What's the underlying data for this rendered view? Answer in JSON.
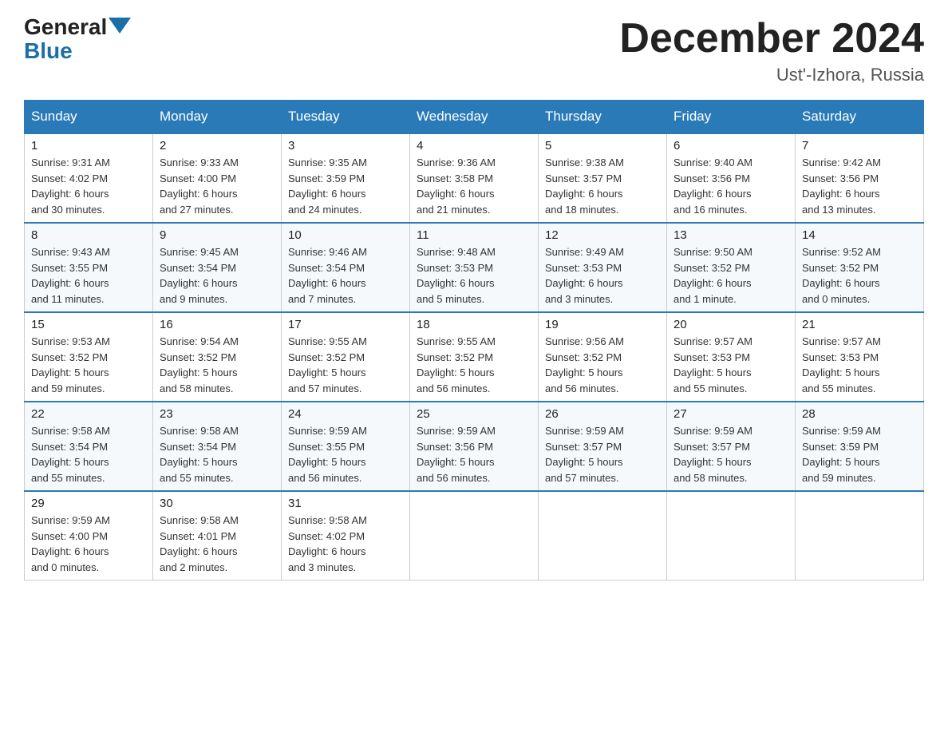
{
  "header": {
    "logo_general": "General",
    "logo_blue": "Blue",
    "month_title": "December 2024",
    "location": "Ust'-Izhora, Russia"
  },
  "weekdays": [
    "Sunday",
    "Monday",
    "Tuesday",
    "Wednesday",
    "Thursday",
    "Friday",
    "Saturday"
  ],
  "weeks": [
    [
      {
        "day": "1",
        "sunrise": "Sunrise: 9:31 AM",
        "sunset": "Sunset: 4:02 PM",
        "daylight": "Daylight: 6 hours",
        "daylight2": "and 30 minutes."
      },
      {
        "day": "2",
        "sunrise": "Sunrise: 9:33 AM",
        "sunset": "Sunset: 4:00 PM",
        "daylight": "Daylight: 6 hours",
        "daylight2": "and 27 minutes."
      },
      {
        "day": "3",
        "sunrise": "Sunrise: 9:35 AM",
        "sunset": "Sunset: 3:59 PM",
        "daylight": "Daylight: 6 hours",
        "daylight2": "and 24 minutes."
      },
      {
        "day": "4",
        "sunrise": "Sunrise: 9:36 AM",
        "sunset": "Sunset: 3:58 PM",
        "daylight": "Daylight: 6 hours",
        "daylight2": "and 21 minutes."
      },
      {
        "day": "5",
        "sunrise": "Sunrise: 9:38 AM",
        "sunset": "Sunset: 3:57 PM",
        "daylight": "Daylight: 6 hours",
        "daylight2": "and 18 minutes."
      },
      {
        "day": "6",
        "sunrise": "Sunrise: 9:40 AM",
        "sunset": "Sunset: 3:56 PM",
        "daylight": "Daylight: 6 hours",
        "daylight2": "and 16 minutes."
      },
      {
        "day": "7",
        "sunrise": "Sunrise: 9:42 AM",
        "sunset": "Sunset: 3:56 PM",
        "daylight": "Daylight: 6 hours",
        "daylight2": "and 13 minutes."
      }
    ],
    [
      {
        "day": "8",
        "sunrise": "Sunrise: 9:43 AM",
        "sunset": "Sunset: 3:55 PM",
        "daylight": "Daylight: 6 hours",
        "daylight2": "and 11 minutes."
      },
      {
        "day": "9",
        "sunrise": "Sunrise: 9:45 AM",
        "sunset": "Sunset: 3:54 PM",
        "daylight": "Daylight: 6 hours",
        "daylight2": "and 9 minutes."
      },
      {
        "day": "10",
        "sunrise": "Sunrise: 9:46 AM",
        "sunset": "Sunset: 3:54 PM",
        "daylight": "Daylight: 6 hours",
        "daylight2": "and 7 minutes."
      },
      {
        "day": "11",
        "sunrise": "Sunrise: 9:48 AM",
        "sunset": "Sunset: 3:53 PM",
        "daylight": "Daylight: 6 hours",
        "daylight2": "and 5 minutes."
      },
      {
        "day": "12",
        "sunrise": "Sunrise: 9:49 AM",
        "sunset": "Sunset: 3:53 PM",
        "daylight": "Daylight: 6 hours",
        "daylight2": "and 3 minutes."
      },
      {
        "day": "13",
        "sunrise": "Sunrise: 9:50 AM",
        "sunset": "Sunset: 3:52 PM",
        "daylight": "Daylight: 6 hours",
        "daylight2": "and 1 minute."
      },
      {
        "day": "14",
        "sunrise": "Sunrise: 9:52 AM",
        "sunset": "Sunset: 3:52 PM",
        "daylight": "Daylight: 6 hours",
        "daylight2": "and 0 minutes."
      }
    ],
    [
      {
        "day": "15",
        "sunrise": "Sunrise: 9:53 AM",
        "sunset": "Sunset: 3:52 PM",
        "daylight": "Daylight: 5 hours",
        "daylight2": "and 59 minutes."
      },
      {
        "day": "16",
        "sunrise": "Sunrise: 9:54 AM",
        "sunset": "Sunset: 3:52 PM",
        "daylight": "Daylight: 5 hours",
        "daylight2": "and 58 minutes."
      },
      {
        "day": "17",
        "sunrise": "Sunrise: 9:55 AM",
        "sunset": "Sunset: 3:52 PM",
        "daylight": "Daylight: 5 hours",
        "daylight2": "and 57 minutes."
      },
      {
        "day": "18",
        "sunrise": "Sunrise: 9:55 AM",
        "sunset": "Sunset: 3:52 PM",
        "daylight": "Daylight: 5 hours",
        "daylight2": "and 56 minutes."
      },
      {
        "day": "19",
        "sunrise": "Sunrise: 9:56 AM",
        "sunset": "Sunset: 3:52 PM",
        "daylight": "Daylight: 5 hours",
        "daylight2": "and 56 minutes."
      },
      {
        "day": "20",
        "sunrise": "Sunrise: 9:57 AM",
        "sunset": "Sunset: 3:53 PM",
        "daylight": "Daylight: 5 hours",
        "daylight2": "and 55 minutes."
      },
      {
        "day": "21",
        "sunrise": "Sunrise: 9:57 AM",
        "sunset": "Sunset: 3:53 PM",
        "daylight": "Daylight: 5 hours",
        "daylight2": "and 55 minutes."
      }
    ],
    [
      {
        "day": "22",
        "sunrise": "Sunrise: 9:58 AM",
        "sunset": "Sunset: 3:54 PM",
        "daylight": "Daylight: 5 hours",
        "daylight2": "and 55 minutes."
      },
      {
        "day": "23",
        "sunrise": "Sunrise: 9:58 AM",
        "sunset": "Sunset: 3:54 PM",
        "daylight": "Daylight: 5 hours",
        "daylight2": "and 55 minutes."
      },
      {
        "day": "24",
        "sunrise": "Sunrise: 9:59 AM",
        "sunset": "Sunset: 3:55 PM",
        "daylight": "Daylight: 5 hours",
        "daylight2": "and 56 minutes."
      },
      {
        "day": "25",
        "sunrise": "Sunrise: 9:59 AM",
        "sunset": "Sunset: 3:56 PM",
        "daylight": "Daylight: 5 hours",
        "daylight2": "and 56 minutes."
      },
      {
        "day": "26",
        "sunrise": "Sunrise: 9:59 AM",
        "sunset": "Sunset: 3:57 PM",
        "daylight": "Daylight: 5 hours",
        "daylight2": "and 57 minutes."
      },
      {
        "day": "27",
        "sunrise": "Sunrise: 9:59 AM",
        "sunset": "Sunset: 3:57 PM",
        "daylight": "Daylight: 5 hours",
        "daylight2": "and 58 minutes."
      },
      {
        "day": "28",
        "sunrise": "Sunrise: 9:59 AM",
        "sunset": "Sunset: 3:59 PM",
        "daylight": "Daylight: 5 hours",
        "daylight2": "and 59 minutes."
      }
    ],
    [
      {
        "day": "29",
        "sunrise": "Sunrise: 9:59 AM",
        "sunset": "Sunset: 4:00 PM",
        "daylight": "Daylight: 6 hours",
        "daylight2": "and 0 minutes."
      },
      {
        "day": "30",
        "sunrise": "Sunrise: 9:58 AM",
        "sunset": "Sunset: 4:01 PM",
        "daylight": "Daylight: 6 hours",
        "daylight2": "and 2 minutes."
      },
      {
        "day": "31",
        "sunrise": "Sunrise: 9:58 AM",
        "sunset": "Sunset: 4:02 PM",
        "daylight": "Daylight: 6 hours",
        "daylight2": "and 3 minutes."
      },
      {
        "day": "",
        "sunrise": "",
        "sunset": "",
        "daylight": "",
        "daylight2": ""
      },
      {
        "day": "",
        "sunrise": "",
        "sunset": "",
        "daylight": "",
        "daylight2": ""
      },
      {
        "day": "",
        "sunrise": "",
        "sunset": "",
        "daylight": "",
        "daylight2": ""
      },
      {
        "day": "",
        "sunrise": "",
        "sunset": "",
        "daylight": "",
        "daylight2": ""
      }
    ]
  ]
}
